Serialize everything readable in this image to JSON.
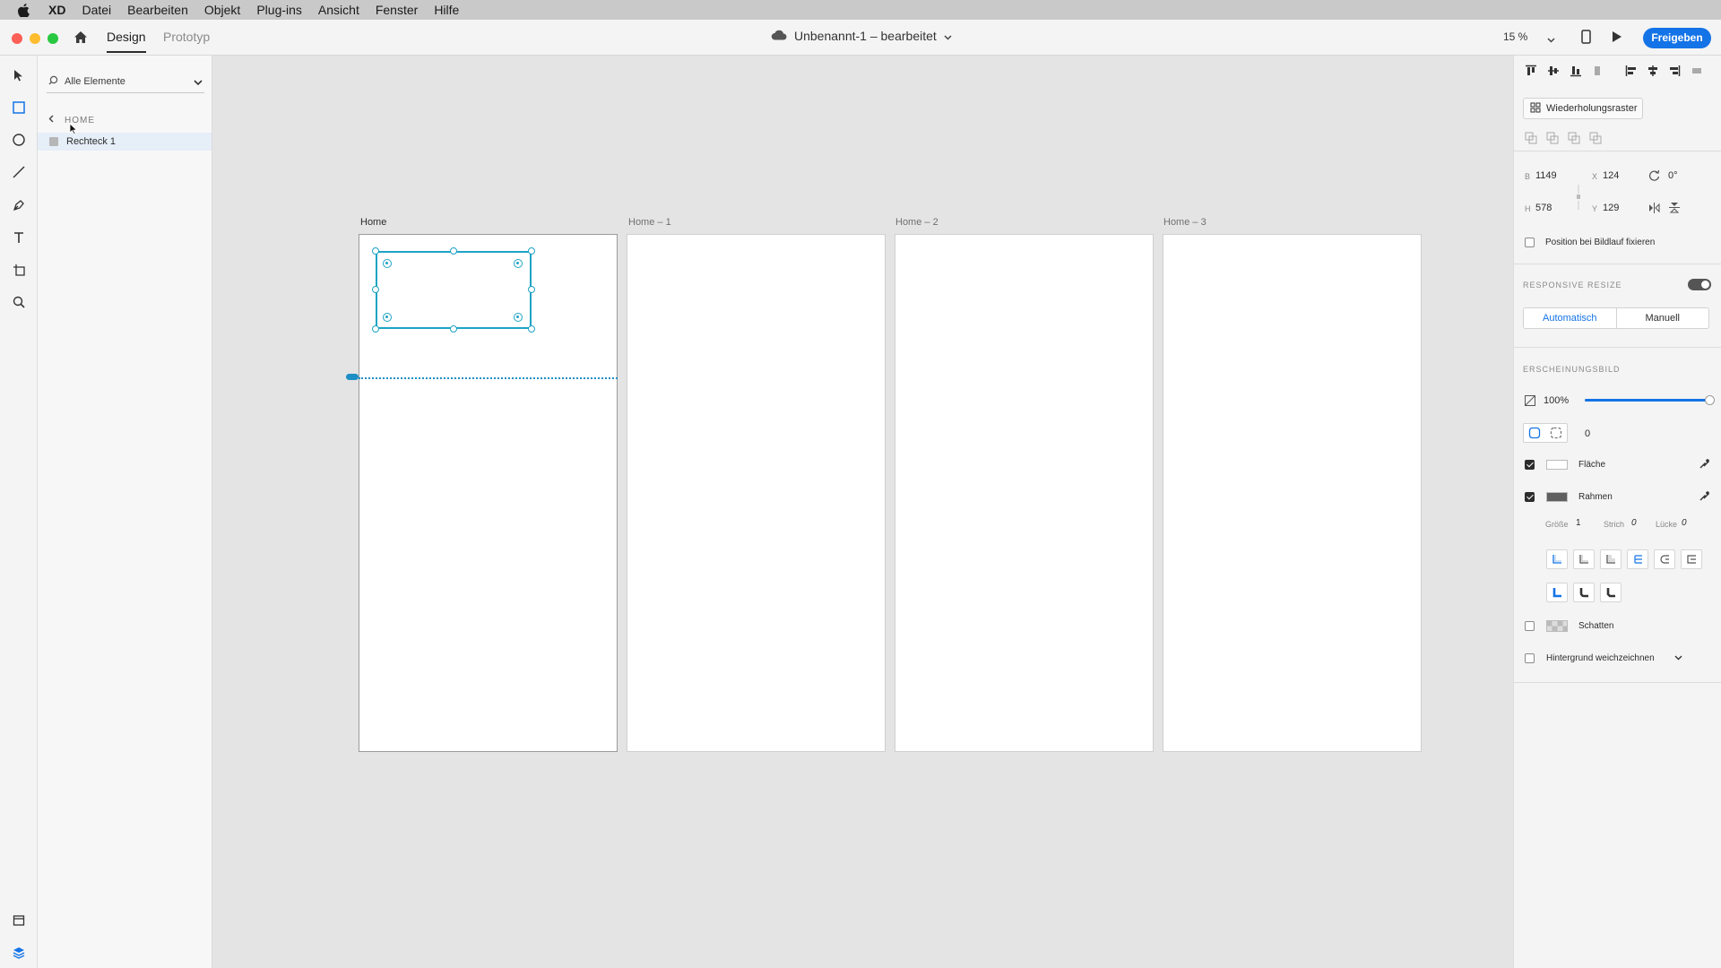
{
  "menubar": {
    "app_name": "XD",
    "items": [
      "Datei",
      "Bearbeiten",
      "Objekt",
      "Plug-ins",
      "Ansicht",
      "Fenster",
      "Hilfe"
    ]
  },
  "titlebar": {
    "tabs": [
      "Design",
      "Prototyp"
    ],
    "document_title": "Unbenannt-1 – bearbeitet",
    "zoom": "15 %",
    "share_label": "Freigeben"
  },
  "layers": {
    "filter_label": "Alle Elemente",
    "breadcrumb": "HOME",
    "items": [
      {
        "label": "Rechteck 1"
      }
    ]
  },
  "artboards": [
    {
      "label": "Home"
    },
    {
      "label": "Home – 1"
    },
    {
      "label": "Home – 2"
    },
    {
      "label": "Home – 3"
    }
  ],
  "inspector": {
    "repeat_grid_label": "Wiederholungsraster",
    "dimensions": {
      "w_label": "B",
      "w": "1149",
      "h_label": "H",
      "h": "578",
      "x_label": "X",
      "x": "124",
      "y_label": "Y",
      "y": "129",
      "rotation": "0°"
    },
    "fix_position_label": "Position bei Bildlauf fixieren",
    "responsive_title": "RESPONSIVE RESIZE",
    "responsive_modes": [
      "Automatisch",
      "Manuell"
    ],
    "appearance_title": "ERSCHEINUNGSBILD",
    "opacity": "100%",
    "opacity_level": 1.0,
    "corner_radius": "0",
    "fill_label": "Fläche",
    "fill_color": "#ffffff",
    "border_label": "Rahmen",
    "border_color": "#5f5f5f",
    "size_label": "Größe",
    "size": "1",
    "dash_label": "Strich",
    "dash": "0",
    "gap_label": "Lücke",
    "gap": "0",
    "shadow_label": "Schatten",
    "blur_label": "Hintergrund weichzeichnen"
  }
}
